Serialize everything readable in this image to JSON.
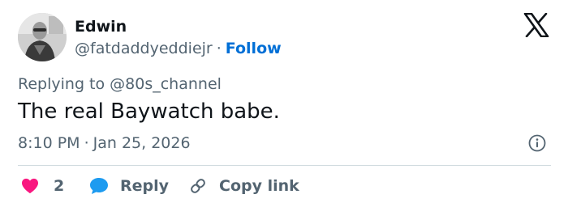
{
  "author": {
    "name": "Edwin",
    "handle": "@fatdaddyeddiejr",
    "separator": "·",
    "follow_label": "Follow"
  },
  "tweet": {
    "replying_to": "Replying to @80s_channel",
    "text": "The real Baywatch babe.",
    "time": "8:10 PM",
    "separator": "·",
    "date": "Jan 25, 2026"
  },
  "actions": {
    "like_count": "2",
    "reply_label": "Reply",
    "copy_link_label": "Copy link"
  },
  "colors": {
    "text_primary": "#0f1419",
    "text_secondary": "#536471",
    "follow_blue": "#006fd6",
    "like_pink": "#f91880",
    "reply_blue": "#1d9bf0",
    "divider": "#cfd9de"
  },
  "icons": [
    "x-logo-icon",
    "info-icon",
    "heart-icon",
    "speech-bubble-icon",
    "link-icon"
  ]
}
